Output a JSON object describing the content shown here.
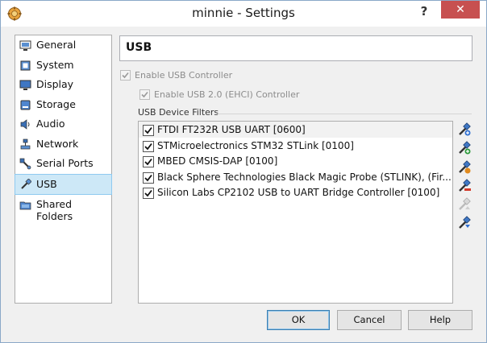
{
  "window": {
    "title": "minnie - Settings",
    "help": "?",
    "close": "✕"
  },
  "sidebar": {
    "items": [
      {
        "label": "General",
        "icon": "general-icon"
      },
      {
        "label": "System",
        "icon": "system-icon"
      },
      {
        "label": "Display",
        "icon": "display-icon"
      },
      {
        "label": "Storage",
        "icon": "storage-icon"
      },
      {
        "label": "Audio",
        "icon": "audio-icon"
      },
      {
        "label": "Network",
        "icon": "network-icon"
      },
      {
        "label": "Serial Ports",
        "icon": "serial-ports-icon"
      },
      {
        "label": "USB",
        "icon": "usb-icon",
        "selected": true
      },
      {
        "label": "Shared Folders",
        "icon": "shared-folders-icon"
      }
    ]
  },
  "main": {
    "section_title": "USB",
    "enable_usb": {
      "label": "Enable USB Controller",
      "checked": true
    },
    "enable_usb2": {
      "label": "Enable USB 2.0 (EHCI) Controller",
      "checked": true
    },
    "filters_label": "USB Device Filters",
    "filters": [
      {
        "label": "FTDI FT232R USB UART [0600]",
        "checked": true
      },
      {
        "label": "STMicroelectronics STM32 STLink [0100]",
        "checked": true
      },
      {
        "label": "MBED CMSIS-DAP [0100]",
        "checked": true
      },
      {
        "label": "Black Sphere Technologies Black Magic Probe (STLINK), (Fir...",
        "checked": true
      },
      {
        "label": "Silicon Labs CP2102 USB to UART Bridge Controller [0100]",
        "checked": true
      }
    ],
    "tools": [
      "add-empty-filter-icon",
      "add-filter-from-device-icon",
      "edit-filter-icon",
      "remove-filter-icon",
      "move-filter-up-icon",
      "move-filter-down-icon"
    ]
  },
  "buttons": {
    "ok": "OK",
    "cancel": "Cancel",
    "help": "Help"
  },
  "colors": {
    "selection": "#cde8f7",
    "close": "#c75050",
    "default_button_border": "#3c7fb1"
  }
}
